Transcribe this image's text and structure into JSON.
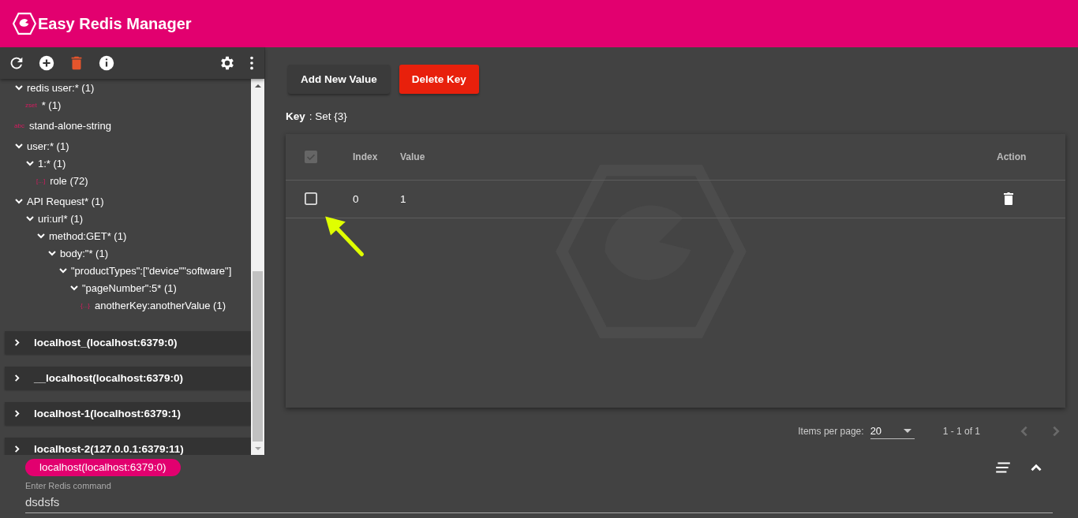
{
  "app_bar": {
    "title": "Easy Redis Manager"
  },
  "tree": [
    {
      "label": "redis user:* (1)",
      "expanded": true,
      "children": [
        {
          "badge": "zset",
          "label": "* (1)"
        }
      ]
    },
    {
      "badge": "abc",
      "label": "stand-alone-string"
    },
    {
      "label": "user:* (1)",
      "expanded": true,
      "children": [
        {
          "label": "1:* (1)",
          "expanded": true,
          "children": [
            {
              "badge": "[...]",
              "label": "role (72)"
            }
          ]
        }
      ]
    },
    {
      "label": "API Request* (1)",
      "expanded": true,
      "children": [
        {
          "label": "uri:url* (1)",
          "expanded": true,
          "children": [
            {
              "label": "method:GET* (1)",
              "expanded": true,
              "children": [
                {
                  "label": "body:\"* (1)",
                  "expanded": true,
                  "children": [
                    {
                      "label": "\"productTypes\":[\"device\"\"software\"]",
                      "expanded": true,
                      "children": [
                        {
                          "label": "\"pageNumber\":5* (1)",
                          "expanded": true,
                          "children": [
                            {
                              "badge": "{...}",
                              "label": "anotherKey:anotherValue (1)"
                            }
                          ]
                        }
                      ]
                    }
                  ]
                }
              ]
            }
          ]
        }
      ]
    }
  ],
  "servers": [
    {
      "label": "localhost_(localhost:6379:0)",
      "expanded": false
    },
    {
      "label": "__localhost(localhost:6379:0)",
      "expanded": false
    },
    {
      "label": "localhost-1(localhost:6379:1)",
      "expanded": false
    },
    {
      "label": "localhost-2(127.0.0.1:6379:11)",
      "expanded": false
    }
  ],
  "buttons": [
    {
      "label": "Add New Value",
      "kind": "plain"
    },
    {
      "label": "Delete Key",
      "kind": "danger"
    }
  ],
  "key_info": {
    "label": "Key",
    "value": ": Set {3}"
  },
  "table": {
    "select_all": {
      "checked": true,
      "disabled": true
    },
    "columns": [
      "Index",
      "Value",
      "Action"
    ],
    "rows": [
      {
        "checked": false,
        "index": "0",
        "value": "1"
      }
    ]
  },
  "paginator": {
    "label": "Items per page:",
    "page_size": "20",
    "range": "1 - 1 of 1",
    "prev_disabled": true,
    "next_disabled": true
  },
  "command": {
    "connection": "localhost(localhost:6379:0)",
    "placeholder": "Enter Redis command",
    "value": "dsdsfs"
  }
}
